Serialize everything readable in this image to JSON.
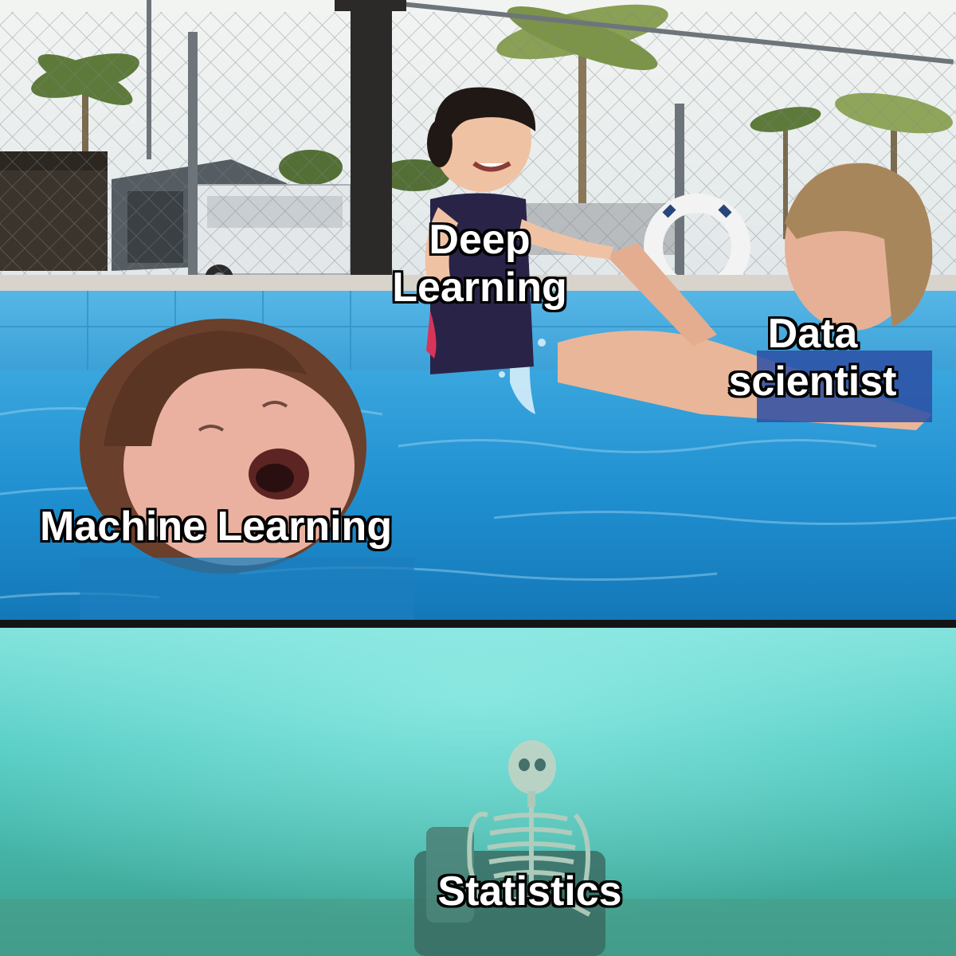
{
  "captions": {
    "deep_learning": [
      "Deep",
      "Learning"
    ],
    "data_scientist": [
      "Data",
      "scientist"
    ],
    "machine_learning": "Machine Learning",
    "statistics": "Statistics"
  },
  "colors": {
    "pool_water": "#1f8fd0",
    "deep_water": "#3fbfb5",
    "sky": "#e6edf0",
    "caption_text": "#ffffff",
    "caption_outline": "#000000"
  }
}
